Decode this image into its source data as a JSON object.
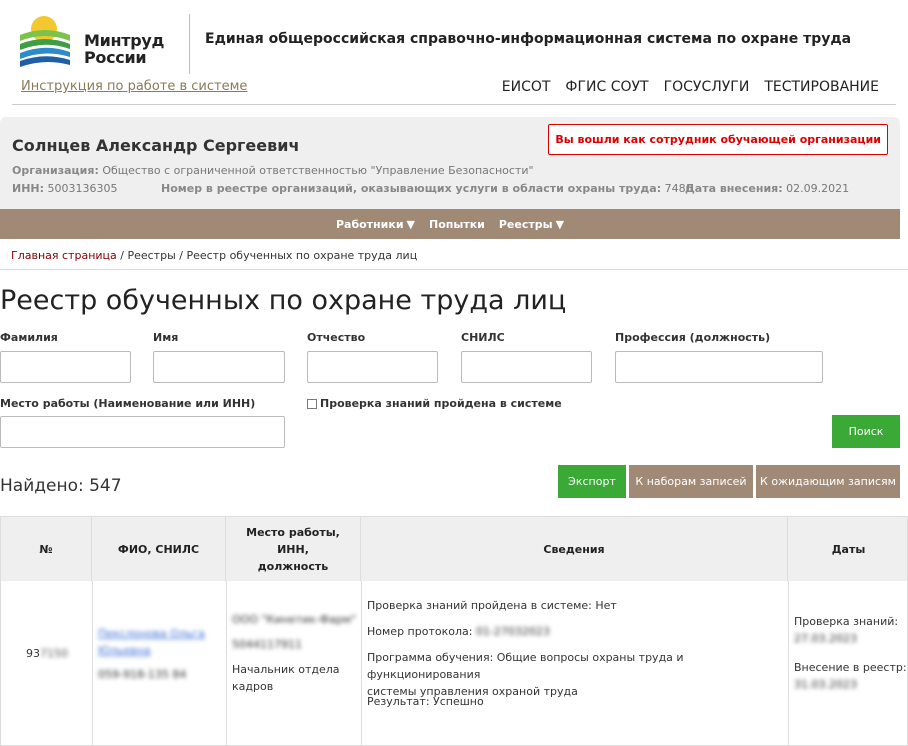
{
  "header": {
    "brand_line1": "Минтруд",
    "brand_line2": "России",
    "system_title": "Единая общероссийская справочно-информационная система по охране труда",
    "instruction_link": "Инструкция по работе в системе",
    "nav": [
      "ЕИСОТ",
      "ФГИС СОУТ",
      "ГОСУСЛУГИ",
      "ТЕСТИРОВАНИЕ"
    ]
  },
  "user": {
    "name": "Солнцев Александр Сергеевич",
    "role_alert": "Вы вошли как сотрудник обучающей организации",
    "org_label": "Организация:",
    "org_value": "Общество с ограниченной ответственностью \"Управление Безопасности\"",
    "inn_label": "ИНН:",
    "inn_value": "5003136305",
    "registry_label": "Номер в реестре организаций, оказывающих услуги в области охраны труда:",
    "registry_value": "7486",
    "date_label": "Дата внесения:",
    "date_value": "02.09.2021"
  },
  "menu": {
    "workers": "Работники",
    "attempts": "Попытки",
    "registries": "Реестры"
  },
  "breadcrumb": {
    "home": "Главная страница",
    "sep1": " / ",
    "registries": "Реестры",
    "sep2": " / ",
    "current": "Реестр обученных по охране труда лиц"
  },
  "page_title": "Реестр обученных по охране труда лиц",
  "filters": {
    "surname": "Фамилия",
    "name": "Имя",
    "patronymic": "Отчество",
    "snils": "СНИЛС",
    "profession": "Профессия (должность)",
    "workplace": "Место работы (Наименование или ИНН)",
    "knowledge_check": "Проверка знаний пройдена в системе",
    "search_button": "Поиск"
  },
  "results": {
    "found": "Найдено: 547",
    "export_button": "Экспорт",
    "sets_button": "К наборам записей",
    "pending_button": "К ожидающим записям"
  },
  "table": {
    "headers": {
      "num": "№",
      "fio": "ФИО, СНИЛС",
      "workplace_l1": "Место работы,",
      "workplace_l2": "ИНН,",
      "workplace_l3": "должность",
      "info": "Сведения",
      "dates": "Даты"
    },
    "rows": [
      {
        "num_visible": "93",
        "num_hidden": "7150",
        "fio_l1": "Пекслонова Ольга",
        "fio_l2": "Юльевна",
        "snils": "059-918-135 84",
        "org": "ООО \"Кинетик-Фарм\"",
        "inn": "5044117911",
        "position_l1": "Начальник отдела",
        "position_l2": "кадров",
        "check": "Проверка знаний пройдена в системе: Нет",
        "protocol_label": "Номер протокола:",
        "protocol_value": "01-27032023",
        "program_l1": "Программа обучения: Общие вопросы охраны труда и функционирования",
        "program_l2": "системы управления охраной труда",
        "result": "Результат: Успешно",
        "knowledge_date_label": "Проверка знаний:",
        "knowledge_date_value": "27.03.2023",
        "registry_date_label": "Внесение в реестр:",
        "registry_date_value": "31.03.2023"
      }
    ]
  },
  "colors": {
    "accent_brown": "#a08a76",
    "green": "#3aa935",
    "alert_red": "#d00000",
    "link_blue": "#3a6fd8"
  }
}
